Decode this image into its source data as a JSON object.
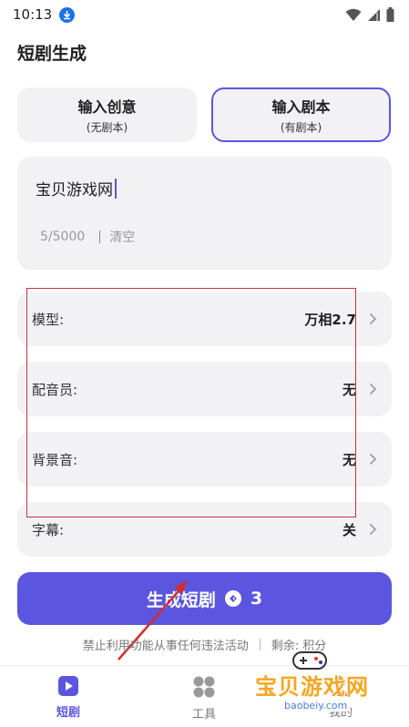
{
  "status_bar": {
    "time": "10:13"
  },
  "page": {
    "title": "短剧生成"
  },
  "mode_tabs": [
    {
      "label": "输入创意",
      "sub": "(无剧本)",
      "selected": false
    },
    {
      "label": "输入剧本",
      "sub": "(有剧本)",
      "selected": true
    }
  ],
  "script_input": {
    "value": "宝贝游戏网",
    "counter": "5/5000",
    "clear_label": "清空"
  },
  "settings": [
    {
      "label": "模型:",
      "value": "万相2.7"
    },
    {
      "label": "配音员:",
      "value": "无"
    },
    {
      "label": "背景音:",
      "value": "无"
    },
    {
      "label": "字幕:",
      "value": "关"
    }
  ],
  "generate_button": {
    "label": "生成短剧",
    "cost": "3"
  },
  "notice": {
    "warning": "禁止利用功能从事任何违法活动",
    "balance": "剩余: 积分"
  },
  "bottom_nav": [
    {
      "label": "短剧",
      "active": true
    },
    {
      "label": "工具",
      "active": false
    },
    {
      "label": "我的",
      "active": false
    }
  ],
  "watermark": {
    "text": "宝贝游戏网",
    "url": "baobeiy.com"
  },
  "colors": {
    "accent": "#5b55e0",
    "card_bg": "#f2f2f5",
    "annotation_red": "#c8343b"
  }
}
